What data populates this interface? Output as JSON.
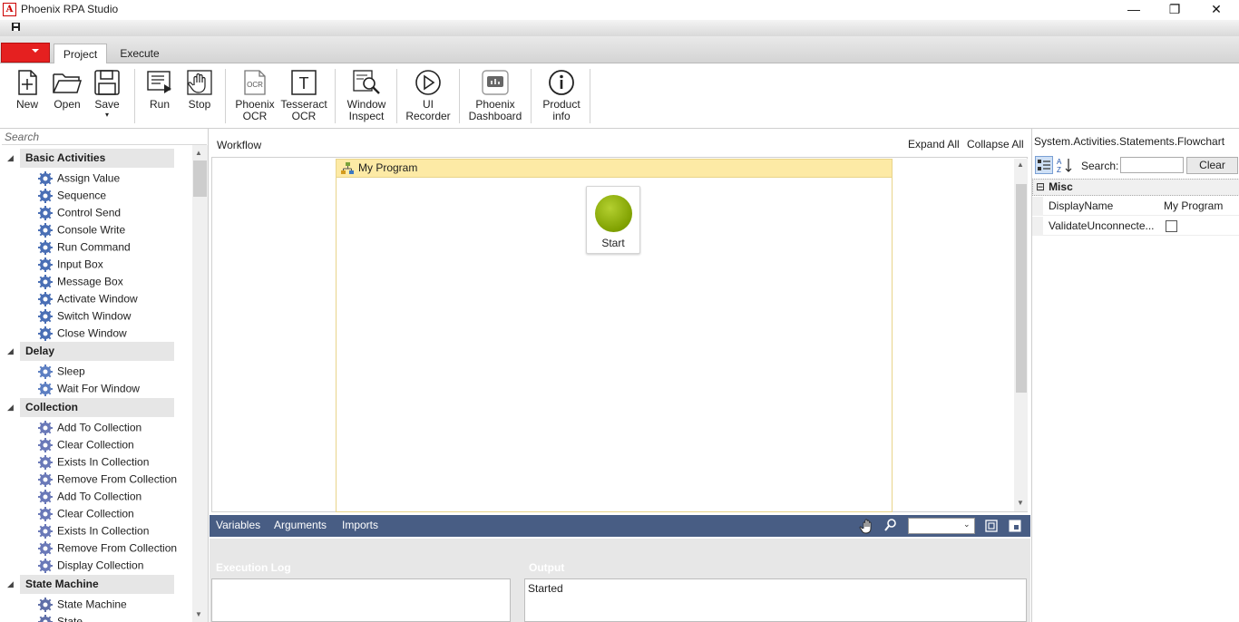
{
  "window": {
    "title": "Phoenix RPA Studio",
    "minimize": "—",
    "restore": "❐",
    "close": "✕"
  },
  "tabs": {
    "project": "Project",
    "execute": "Execute"
  },
  "ribbon": {
    "buttons": [
      {
        "label1": "New",
        "label2": "",
        "icon": "new-file-icon"
      },
      {
        "label1": "Open",
        "label2": "",
        "icon": "folder-open-icon"
      },
      {
        "label1": "Save",
        "label2": "▾",
        "icon": "save-disk-icon"
      },
      {
        "label1": "Run",
        "label2": "",
        "icon": "run-icon"
      },
      {
        "label1": "Stop",
        "label2": "",
        "icon": "stop-hand-icon"
      },
      {
        "label1": "Phoenix",
        "label2": "OCR",
        "icon": "ocr-icon"
      },
      {
        "label1": "Tesseract",
        "label2": "OCR",
        "icon": "text-t-icon"
      },
      {
        "label1": "Window",
        "label2": "Inspect",
        "icon": "inspect-magnifier-icon"
      },
      {
        "label1": "UI",
        "label2": "Recorder",
        "icon": "recorder-play-icon"
      },
      {
        "label1": "Phoenix",
        "label2": "Dashboard",
        "icon": "dashboard-icon"
      },
      {
        "label1": "Product",
        "label2": "info",
        "icon": "info-icon"
      }
    ],
    "ocr_glyph": "OCR",
    "tesseract_glyph": "T"
  },
  "toolbox": {
    "search_placeholder": "Search",
    "categories": [
      {
        "name": "Basic Activities",
        "items": [
          "Assign Value",
          "Sequence",
          "Control Send",
          "Console Write",
          "Run Command",
          "Input Box",
          "Message Box",
          "Activate Window",
          "Switch Window",
          "Close Window"
        ]
      },
      {
        "name": "Delay",
        "items": [
          "Sleep",
          "Wait For Window"
        ]
      },
      {
        "name": "Collection",
        "items": [
          "Add To Collection",
          "Clear Collection",
          "Exists In Collection",
          "Remove From Collection",
          "Add To Collection",
          "Clear Collection",
          "Exists In Collection",
          "Remove From Collection",
          "Display Collection"
        ]
      },
      {
        "name": "State Machine",
        "items": [
          "State Machine",
          "State"
        ]
      }
    ]
  },
  "designer": {
    "label": "Workflow",
    "expand_all": "Expand All",
    "collapse_all": "Collapse All",
    "flowchart_title": "My Program",
    "start_label": "Start",
    "bottom": {
      "variables": "Variables",
      "arguments": "Arguments",
      "imports": "Imports"
    }
  },
  "properties": {
    "type_name": "System.Activities.Statements.Flowchart",
    "search_label": "Search:",
    "search_value": "",
    "clear_label": "Clear",
    "category": "Misc",
    "category_toggle": "⊟",
    "rows": [
      {
        "name": "DisplayName",
        "value": "My Program"
      },
      {
        "name": "ValidateUnconnecte...",
        "value": ""
      }
    ]
  },
  "log": {
    "execution_log_title": "Execution Log",
    "output_title": "Output",
    "output_text": "Started"
  }
}
